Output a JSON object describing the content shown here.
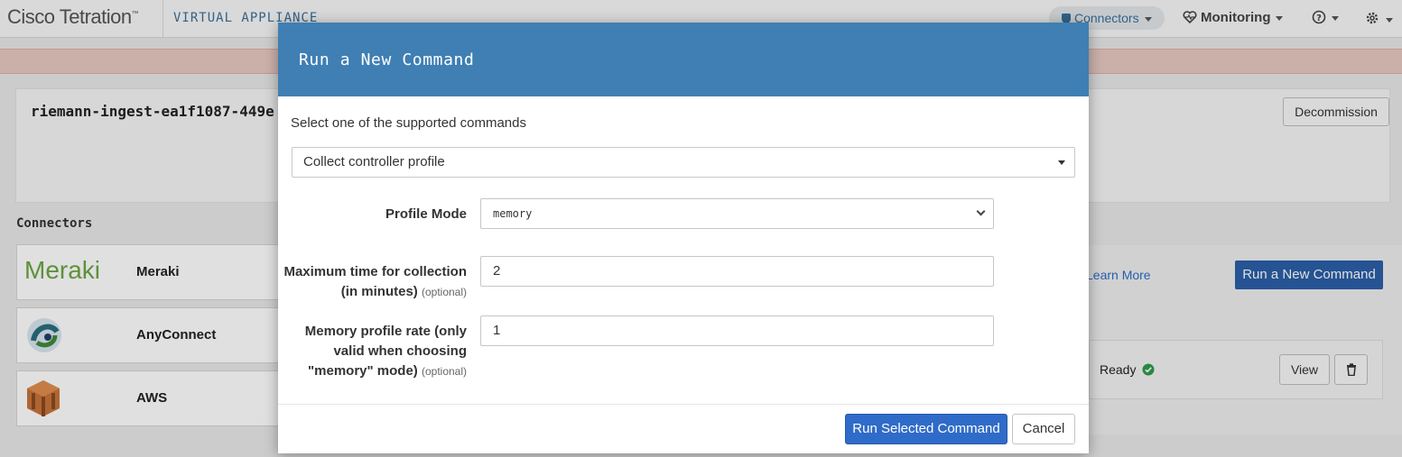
{
  "nav": {
    "brand": "Cisco Tetration",
    "brand_tm": "™",
    "app_name": "VIRTUAL APPLIANCE",
    "connectors": "Connectors",
    "monitoring": "Monitoring"
  },
  "background": {
    "appliance_name": "riemann-ingest-ea1f1087-449e",
    "decommission": "Decommission",
    "connectors_heading": "Connectors",
    "connectors": [
      {
        "name": "Meraki",
        "logo_text": "Meraki"
      },
      {
        "name": "AnyConnect"
      },
      {
        "name": "AWS"
      }
    ],
    "learn_more": "Learn More",
    "run_new_command": "Run a New Command",
    "status": "Ready",
    "view": "View"
  },
  "modal": {
    "title": "Run a New Command",
    "instruction": "Select one of the supported commands",
    "selected_command": "Collect controller profile",
    "fields": {
      "profile_mode": {
        "label": "Profile Mode",
        "value": "memory"
      },
      "max_time": {
        "label_1": "Maximum time for collection",
        "label_2": "(in minutes)",
        "optional": "(optional)",
        "value": "2"
      },
      "memory_rate": {
        "label_1": "Memory profile rate (only",
        "label_2": "valid when choosing",
        "label_3": "\"memory\" mode)",
        "optional": "(optional)",
        "value": "1"
      }
    },
    "run_button": "Run Selected Command",
    "cancel_button": "Cancel"
  },
  "colors": {
    "modal_header": "#3f7fb3",
    "primary_button": "#2f6bc8",
    "ready_green": "#2e9a4a",
    "meraki_green": "#6ba644"
  }
}
